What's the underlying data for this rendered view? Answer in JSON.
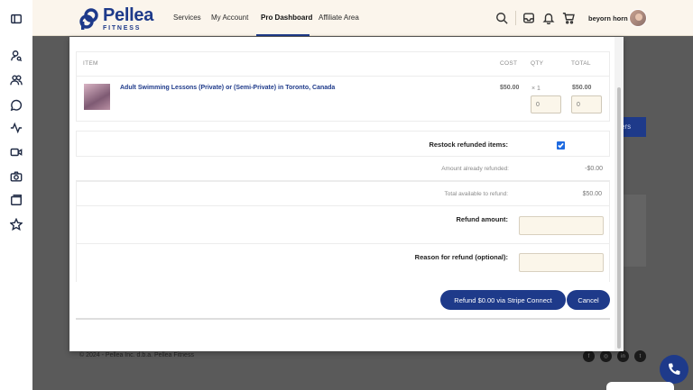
{
  "header": {
    "logo_main": "Pellea",
    "logo_sub": "FITNESS",
    "nav": [
      "Services",
      "My Account",
      "Pro Dashboard",
      "Affiliate Area"
    ],
    "username": "beyorn horn"
  },
  "background": {
    "button_fragment": "ers",
    "footer": "© 2024 - Pellea Inc. d.b.a. Pellea Fitness"
  },
  "modal": {
    "columns": {
      "item": "ITEM",
      "cost": "COST",
      "qty": "QTY",
      "total": "TOTAL"
    },
    "item": {
      "name": "Adult Swimming Lessons (Private) or (Semi-Private) in Toronto, Canada",
      "cost": "$50.00",
      "qty": "× 1",
      "total": "$50.00",
      "qty_input_placeholder": "0",
      "total_input_placeholder": "0"
    },
    "restock_label": "Restock refunded items:",
    "restock_checked": true,
    "already_refunded_label": "Amount already refunded:",
    "already_refunded_value": "-$0.00",
    "available_label": "Total available to refund:",
    "available_value": "$50.00",
    "refund_amount_label": "Refund amount:",
    "reason_label": "Reason for refund (optional):",
    "refund_button": "Refund $0.00 via Stripe Connect",
    "cancel_button": "Cancel"
  },
  "colors": {
    "brand": "#1e3a8a",
    "header_bg": "#fbf5ec",
    "input_bg": "#fbf6ea",
    "checkbox": "#1e6ae0"
  }
}
